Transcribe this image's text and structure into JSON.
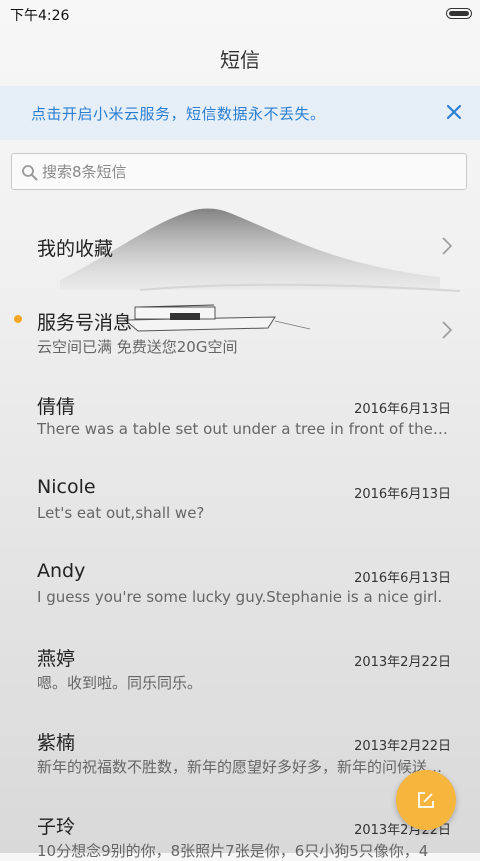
{
  "status": {
    "time": "下午4:26"
  },
  "header": {
    "title": "短信"
  },
  "banner": {
    "text": "点击开启小米云服务，短信数据永不丢失。"
  },
  "search": {
    "placeholder": "搜索8条短信"
  },
  "favorites": {
    "label": "我的收藏"
  },
  "service": {
    "label": "服务号消息",
    "preview": "云空间已满 免费送您20G空间"
  },
  "conversations": [
    {
      "name": "倩倩",
      "date": "2016年6月13日",
      "preview": "There was a table set out under a tree in front of the house"
    },
    {
      "name": "Nicole",
      "date": "2016年6月13日",
      "preview": "Let's eat out,shall we?"
    },
    {
      "name": "Andy",
      "date": "2016年6月13日",
      "preview": "I guess you're some lucky guy.Stephanie is a nice girl."
    },
    {
      "name": "燕婷",
      "date": "2013年2月22日",
      "preview": "嗯。收到啦。同乐同乐。"
    },
    {
      "name": "紫楠",
      "date": "2013年2月22日",
      "preview": "新年的祝福数不胜数，新年的愿望好多好多，新年的问候送给你"
    },
    {
      "name": "子玲",
      "date": "2013年2月22日",
      "preview": "10分想念9别的你，8张照片7张是你，6只小狗5只像你，4"
    }
  ],
  "colors": {
    "accent": "#2b7fd3",
    "banner_bg": "#e6eef7",
    "fab": "#f6b63e",
    "unread_dot": "#f5a623"
  },
  "icons": {
    "close": "close-icon",
    "search": "search-icon",
    "chevron": "chevron-right-icon",
    "compose": "compose-icon"
  }
}
